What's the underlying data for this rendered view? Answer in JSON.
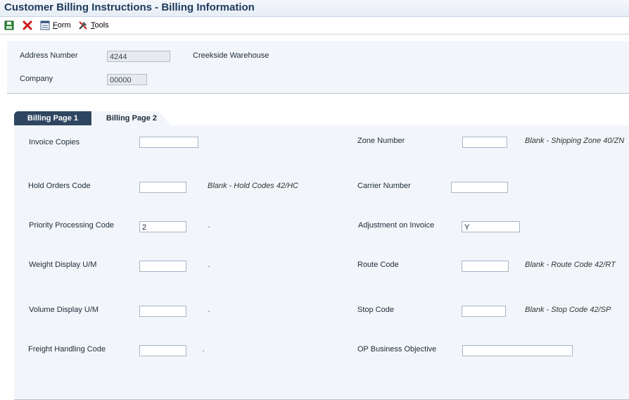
{
  "window": {
    "title": "Customer Billing Instructions - Billing Information"
  },
  "toolbar": {
    "form_label_ul": "F",
    "form_label_rest": "orm",
    "tools_label_ul": "T",
    "tools_label_rest": "ools"
  },
  "header": {
    "address_number_label": "Address Number",
    "address_number_value": "4244",
    "address_name": "Creekside Warehouse",
    "company_label": "Company",
    "company_value": "00000"
  },
  "tabs": [
    {
      "label": "Billing Page 1",
      "active": false
    },
    {
      "label": "Billing Page 2",
      "active": true
    }
  ],
  "fields": {
    "invoice_copies": {
      "label": "Invoice Copies",
      "value": ""
    },
    "hold_orders_code": {
      "label": "Hold Orders Code",
      "value": "",
      "hint": "Blank - Hold Codes 42/HC"
    },
    "priority_processing_code": {
      "label": "Priority Processing Code",
      "value": "2",
      "hint": "."
    },
    "weight_display_um": {
      "label": "Weight Display U/M",
      "value": "",
      "hint": "."
    },
    "volume_display_um": {
      "label": "Volume Display U/M",
      "value": "",
      "hint": "."
    },
    "freight_handling_code": {
      "label": "Freight Handling Code",
      "value": "",
      "hint": "."
    },
    "zone_number": {
      "label": "Zone Number",
      "value": "",
      "hint": "Blank - Shipping Zone 40/ZN"
    },
    "carrier_number": {
      "label": "Carrier Number",
      "value": ""
    },
    "adjustment_on_invoice": {
      "label": "Adjustment on Invoice",
      "value": "Y"
    },
    "route_code": {
      "label": "Route Code",
      "value": "",
      "hint": "Blank - Route Code 42/RT"
    },
    "stop_code": {
      "label": "Stop Code",
      "value": "",
      "hint": "Blank - Stop Code 42/SP"
    },
    "op_business_objective": {
      "label": "OP Business Objective",
      "value": ""
    }
  },
  "colors": {
    "accent": "#2f4661",
    "panel": "#f2f6fa",
    "title": "#1d3a5c"
  }
}
